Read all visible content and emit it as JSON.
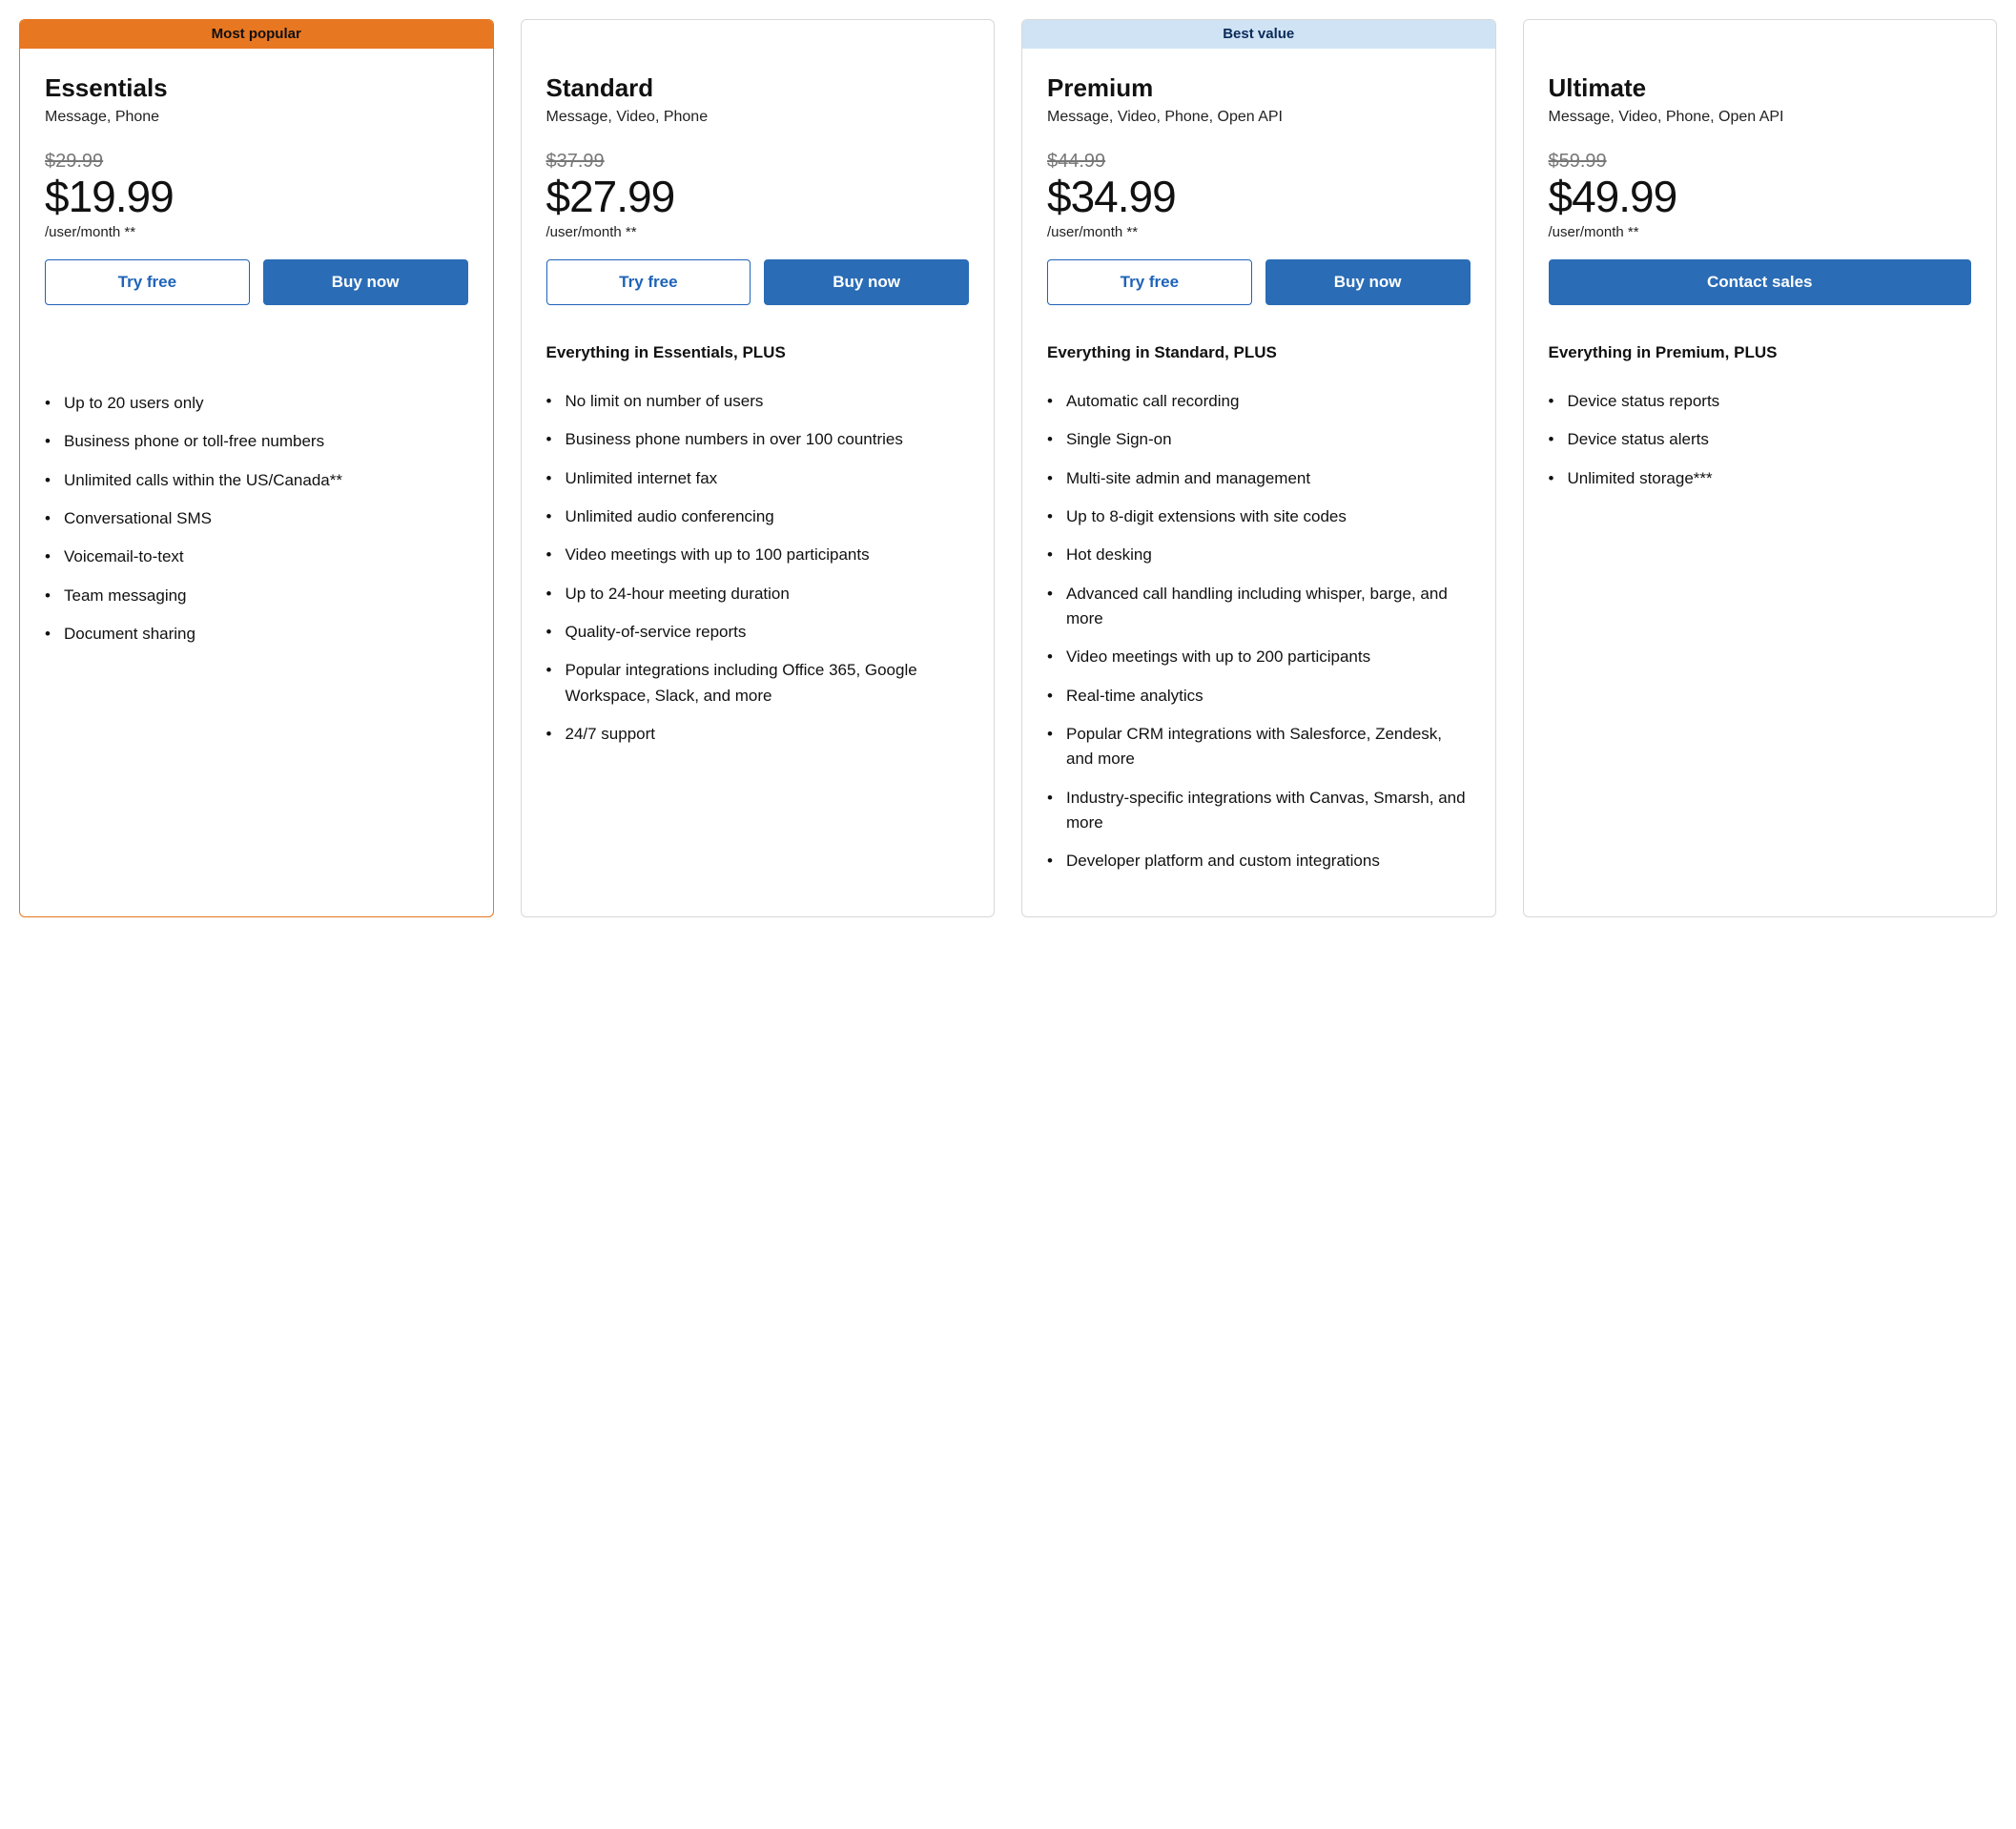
{
  "plans": [
    {
      "tag": "Most popular",
      "tagStyle": "orange",
      "highlight": "orange",
      "name": "Essentials",
      "sub": "Message, Phone",
      "oldPrice": "$29.99",
      "price": "$19.99",
      "per": "/user/month **",
      "buttons": [
        {
          "label": "Try free",
          "style": "outline"
        },
        {
          "label": "Buy now",
          "style": "fill"
        }
      ],
      "plus": "",
      "features": [
        "Up to 20 users only",
        "Business phone or toll-free numbers",
        "Unlimited calls within the US/Canada**",
        "Conversational SMS",
        "Voicemail-to-text",
        "Team messaging",
        "Document sharing"
      ]
    },
    {
      "tag": "",
      "tagStyle": "spacer",
      "highlight": "",
      "name": "Standard",
      "sub": "Message, Video, Phone",
      "oldPrice": "$37.99",
      "price": "$27.99",
      "per": "/user/month **",
      "buttons": [
        {
          "label": "Try free",
          "style": "outline"
        },
        {
          "label": "Buy now",
          "style": "fill"
        }
      ],
      "plus": "Everything in Essentials, PLUS",
      "features": [
        "No limit on number of users",
        "Business phone numbers in over 100 countries",
        "Unlimited internet fax",
        "Unlimited audio conferencing",
        "Video meetings with up to 100 participants",
        "Up to 24-hour meeting duration",
        "Quality-of-service reports",
        "Popular integrations including Office 365, Google Workspace, Slack, and more",
        "24/7 support"
      ]
    },
    {
      "tag": "Best value",
      "tagStyle": "blue",
      "highlight": "",
      "name": "Premium",
      "sub": "Message, Video, Phone, Open API",
      "oldPrice": "$44.99",
      "price": "$34.99",
      "per": "/user/month **",
      "buttons": [
        {
          "label": "Try free",
          "style": "outline"
        },
        {
          "label": "Buy now",
          "style": "fill"
        }
      ],
      "plus": "Everything in Standard, PLUS",
      "features": [
        "Automatic call recording",
        "Single Sign-on",
        "Multi-site admin and management",
        "Up to 8-digit extensions with site codes",
        "Hot desking",
        "Advanced call handling including whisper, barge, and more",
        "Video meetings with up to 200 participants",
        "Real-time analytics",
        "Popular CRM integrations with Salesforce, Zendesk, and more",
        "Industry-specific integrations with Canvas, Smarsh, and more",
        "Developer platform and custom integrations"
      ]
    },
    {
      "tag": "",
      "tagStyle": "spacer",
      "highlight": "",
      "name": "Ultimate",
      "sub": "Message, Video, Phone, Open API",
      "oldPrice": "$59.99",
      "price": "$49.99",
      "per": "/user/month **",
      "buttons": [
        {
          "label": "Contact sales",
          "style": "fill"
        }
      ],
      "plus": "Everything in Premium, PLUS",
      "features": [
        "Device status reports",
        "Device status alerts",
        "Unlimited storage***"
      ]
    }
  ]
}
